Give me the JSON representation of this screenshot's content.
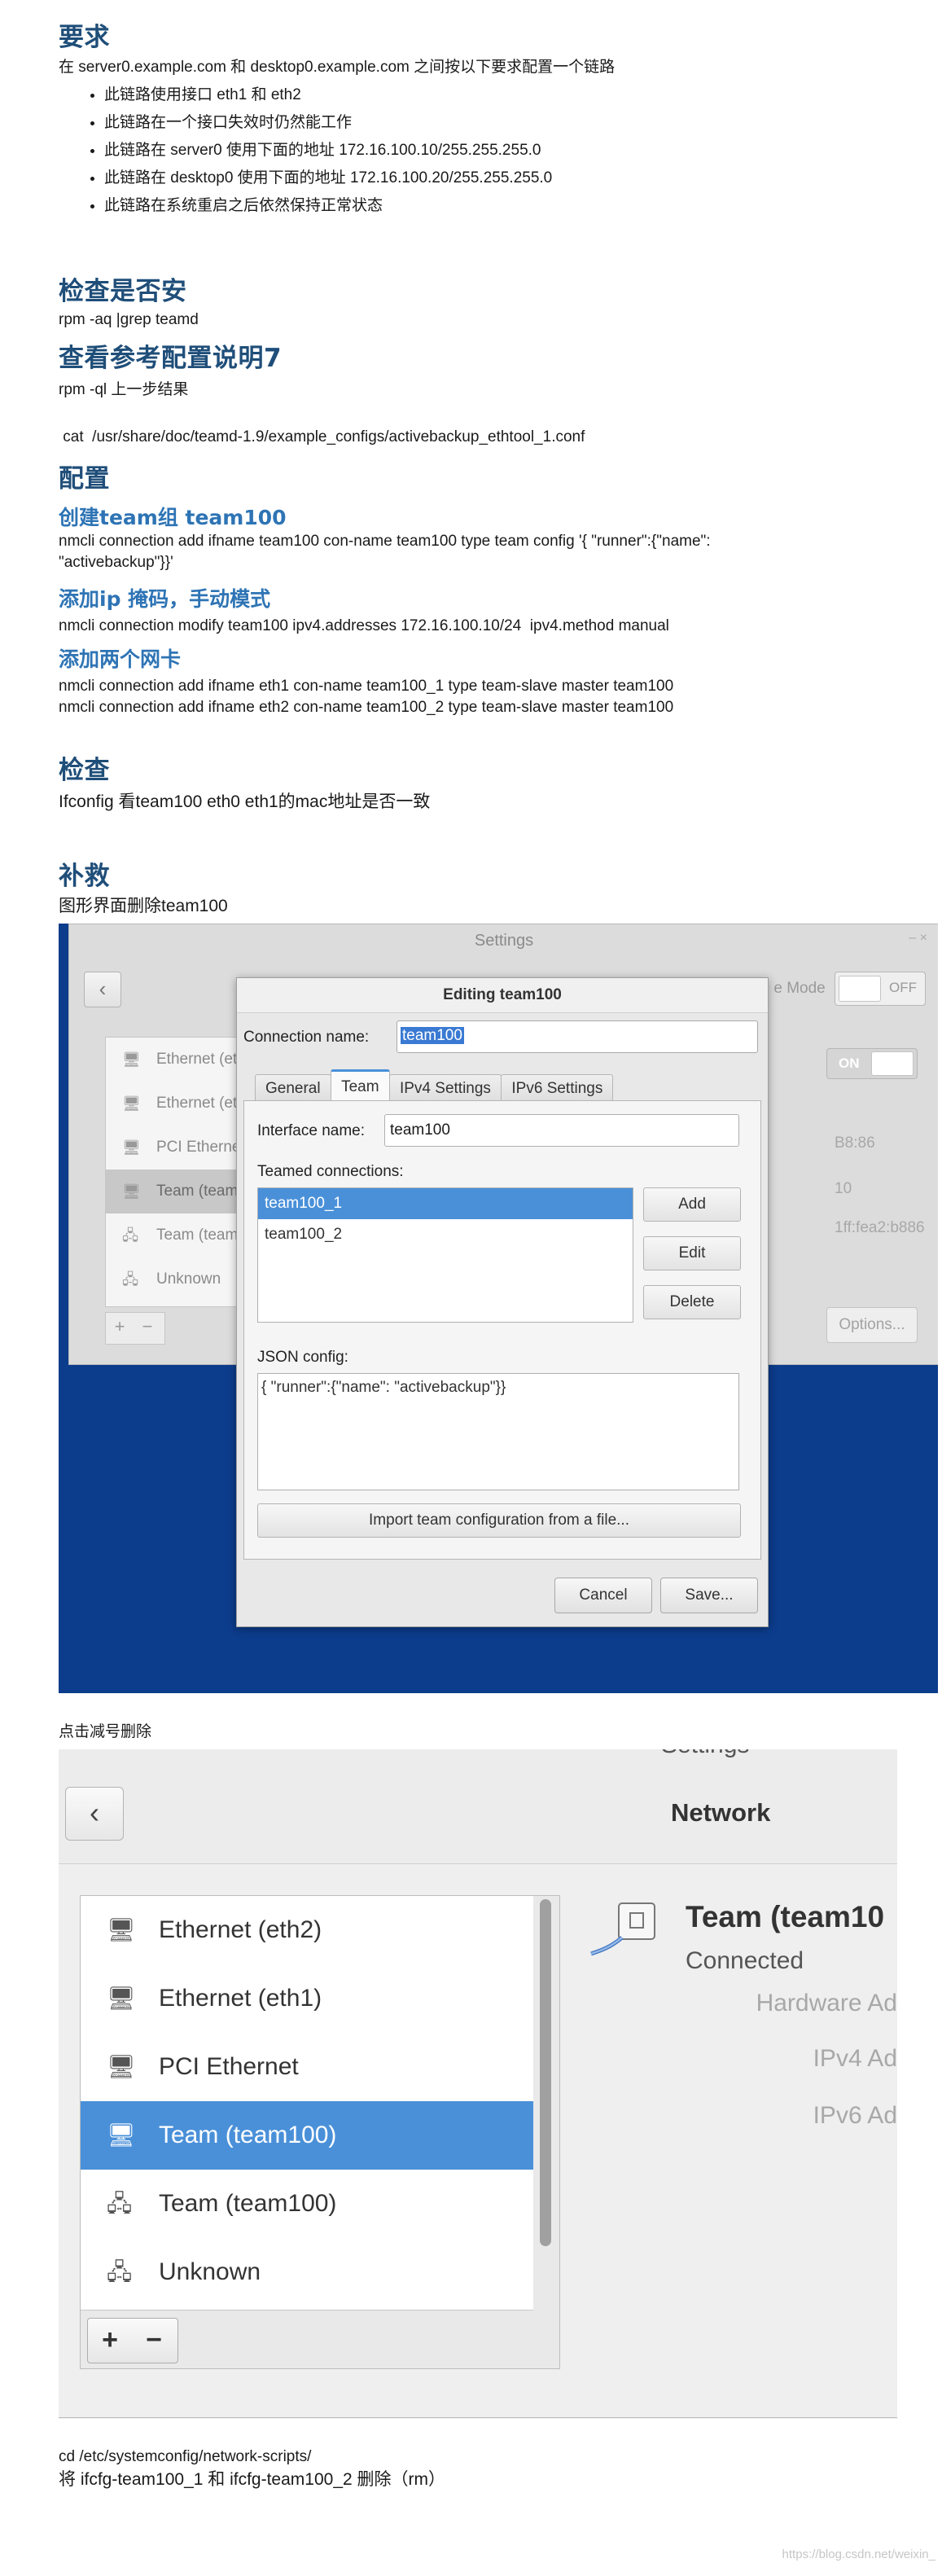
{
  "sections": {
    "requirements": {
      "heading": "要求",
      "intro": "在 server0.example.com 和 desktop0.example.com 之间按以下要求配置一个链路",
      "items": [
        "此链路使用接口 eth1 和 eth2",
        "此链路在一个接口失效时仍然能工作",
        "此链路在 server0 使用下面的地址 172.16.100.10/255.255.255.0",
        "此链路在 desktop0 使用下面的地址 172.16.100.20/255.255.255.0",
        "此链路在系统重启之后依然保持正常状态"
      ]
    },
    "check_install": {
      "heading": "检查是否安",
      "cmd": "rpm -aq |grep teamd"
    },
    "reference": {
      "heading": "查看参考配置说明7",
      "cmd1": "rpm -ql 上一步结果",
      "cmd2": " cat  /usr/share/doc/teamd-1.9/example_configs/activebackup_ethtool_1.conf"
    },
    "config": {
      "heading": "配置",
      "create_heading": "创建team组 team100",
      "create_cmd": "nmcli connection add ifname team100 con-name team100 type team config '{ \"runner\":{\"name\": \"activebackup\"}}'",
      "ip_heading": "添加ip 掩码，手动模式",
      "ip_cmd": "nmcli connection modify team100 ipv4.addresses 172.16.100.10/24  ipv4.method manual",
      "nic_heading": "添加两个网卡",
      "nic_cmd1": "nmcli connection add ifname eth1 con-name team100_1 type team-slave master team100",
      "nic_cmd2": "nmcli connection add ifname eth2 con-name team100_2 type team-slave master team100"
    },
    "verify": {
      "heading": "检查",
      "text": "Ifconfig 看team100 eth0 eth1的mac地址是否一致"
    },
    "remedy": {
      "heading": "补救",
      "text1": "图形界面删除team100",
      "text2": "点击减号删除",
      "cmd": "cd /etc/systemconfig/network-scripts/",
      "text3": "将 ifcfg-team100_1 和 ifcfg-team100_2 删除（rm）"
    }
  },
  "screenshot1": {
    "window_title": "Settings",
    "window_controls": "–  ×",
    "back": "‹",
    "mode_label": "e Mode",
    "off_label": "OFF",
    "on_label": "ON",
    "list": [
      {
        "label": "Ethernet (et",
        "icon": "wired-icon"
      },
      {
        "label": "Ethernet (et",
        "icon": "wired-icon"
      },
      {
        "label": "PCI Etherne",
        "icon": "wired-icon"
      },
      {
        "label": "Team (team",
        "icon": "wired-icon",
        "selected": true
      },
      {
        "label": "Team (team",
        "icon": "team-icon"
      },
      {
        "label": "Unknown",
        "icon": "team-icon"
      }
    ],
    "plus": "+",
    "minus": "−",
    "details": [
      "B8:86",
      "10",
      "1ff:fea2:b886"
    ],
    "options": "Options...",
    "dialog": {
      "title": "Editing team100",
      "conn_name_label": "Connection name:",
      "conn_name_value": "team100",
      "tabs": [
        "General",
        "Team",
        "IPv4 Settings",
        "IPv6 Settings"
      ],
      "active_tab": "Team",
      "iface_label": "Interface name:",
      "iface_value": "team100",
      "teamed_label": "Teamed connections:",
      "teamed": [
        "team100_1",
        "team100_2"
      ],
      "add": "Add",
      "edit": "Edit",
      "delete": "Delete",
      "json_label": "JSON config:",
      "json_value": "{ \"runner\":{\"name\": \"activebackup\"}}",
      "import": "Import team configuration from a file...",
      "cancel": "Cancel",
      "save": "Save..."
    }
  },
  "screenshot2": {
    "cut_title": "Settings",
    "back": "‹",
    "title": "Network",
    "list": [
      {
        "label": "Ethernet (eth2)",
        "icon": "wired-icon"
      },
      {
        "label": "Ethernet (eth1)",
        "icon": "wired-icon"
      },
      {
        "label": "PCI Ethernet",
        "icon": "wired-icon"
      },
      {
        "label": "Team (team100)",
        "icon": "wired-icon",
        "selected": true
      },
      {
        "label": "Team (team100)",
        "icon": "team-icon"
      },
      {
        "label": "Unknown",
        "icon": "team-icon"
      }
    ],
    "plus": "+",
    "minus": "−",
    "device_name": "Team (team10",
    "device_state": "Connected",
    "hw_label": "Hardware Ad",
    "ipv4_label": "IPv4 Ad",
    "ipv6_label": "IPv6 Ad"
  },
  "watermark": "https://blog.csdn.net/weixin_"
}
